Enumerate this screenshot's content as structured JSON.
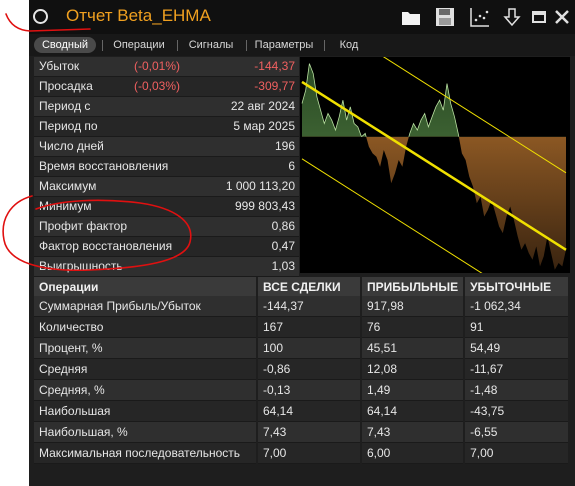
{
  "window": {
    "title": "Отчет Beta_EHMA",
    "toolbar_icons": [
      "folder-icon",
      "save-icon",
      "chart-export-icon",
      "download-icon",
      "minimize-icon",
      "close-icon"
    ]
  },
  "tabs": [
    "Сводный",
    "Операции",
    "Сигналы",
    "Параметры",
    "Код"
  ],
  "active_tab": "Сводный",
  "stats": [
    {
      "label": "Убыток",
      "pct": "(-0,01%)",
      "value": "-144,37"
    },
    {
      "label": "Просадка",
      "pct": "(-0,03%)",
      "value": "-309,77"
    },
    {
      "label": "Период с",
      "pct": "",
      "value": "22 авг 2024"
    },
    {
      "label": "Период по",
      "pct": "",
      "value": "5 мар 2025"
    },
    {
      "label": "Число дней",
      "pct": "",
      "value": "196"
    },
    {
      "label": "Время восстановления",
      "pct": "",
      "value": "6"
    },
    {
      "label": "Максимум",
      "pct": "",
      "value": "1 000 113,20"
    },
    {
      "label": "Минимум",
      "pct": "",
      "value": "999 803,43"
    },
    {
      "label": "Профит фактор",
      "pct": "",
      "value": "0,86"
    },
    {
      "label": "Фактор восстановления",
      "pct": "",
      "value": "0,47"
    },
    {
      "label": "Выигрышность",
      "pct": "",
      "value": "1,03"
    }
  ],
  "ops_table": {
    "headers": [
      "Операции",
      "ВСЕ СДЕЛКИ",
      "ПРИБЫЛЬНЫЕ",
      "УБЫТОЧНЫЕ"
    ],
    "rows": [
      [
        "Суммарная Прибыль/Убыток",
        "-144,37",
        "917,98",
        "-1 062,34"
      ],
      [
        "Количество",
        "167",
        "76",
        "91"
      ],
      [
        "Процент, %",
        "100",
        "45,51",
        "54,49"
      ],
      [
        "Средняя",
        "-0,86",
        "12,08",
        "-11,67"
      ],
      [
        "Средняя, %",
        "-0,13",
        "1,49",
        "-1,48"
      ],
      [
        "Наибольшая",
        "64,14",
        "64,14",
        "-43,75"
      ],
      [
        "Наибольшая, %",
        "7,43",
        "7,43",
        "-6,55"
      ],
      [
        "Максимальная последовательность",
        "7,00",
        "6,00",
        "7,00"
      ]
    ]
  },
  "chart_data": {
    "type": "area",
    "title": "",
    "xlabel": "",
    "ylabel": "",
    "baseline": 0,
    "ylim": [
      -205,
      120
    ],
    "values": [
      50,
      70,
      110,
      95,
      60,
      40,
      20,
      35,
      25,
      10,
      30,
      55,
      25,
      45,
      20,
      15,
      0,
      5,
      -15,
      -25,
      -30,
      -45,
      -20,
      -35,
      -70,
      -55,
      -35,
      -45,
      -15,
      5,
      20,
      10,
      25,
      35,
      15,
      30,
      45,
      55,
      40,
      80,
      50,
      30,
      5,
      -25,
      -35,
      -60,
      -75,
      -100,
      -90,
      -120,
      -110,
      -95,
      -115,
      -135,
      -145,
      -120,
      -105,
      -125,
      -150,
      -170,
      -160,
      -175,
      -185,
      -165,
      -195,
      -180,
      -150,
      -175,
      -200,
      -190,
      -195,
      -170
    ],
    "positive_color": "#5c8a4a",
    "negative_color": "#b8742e",
    "regression_color": "#f0e000"
  }
}
